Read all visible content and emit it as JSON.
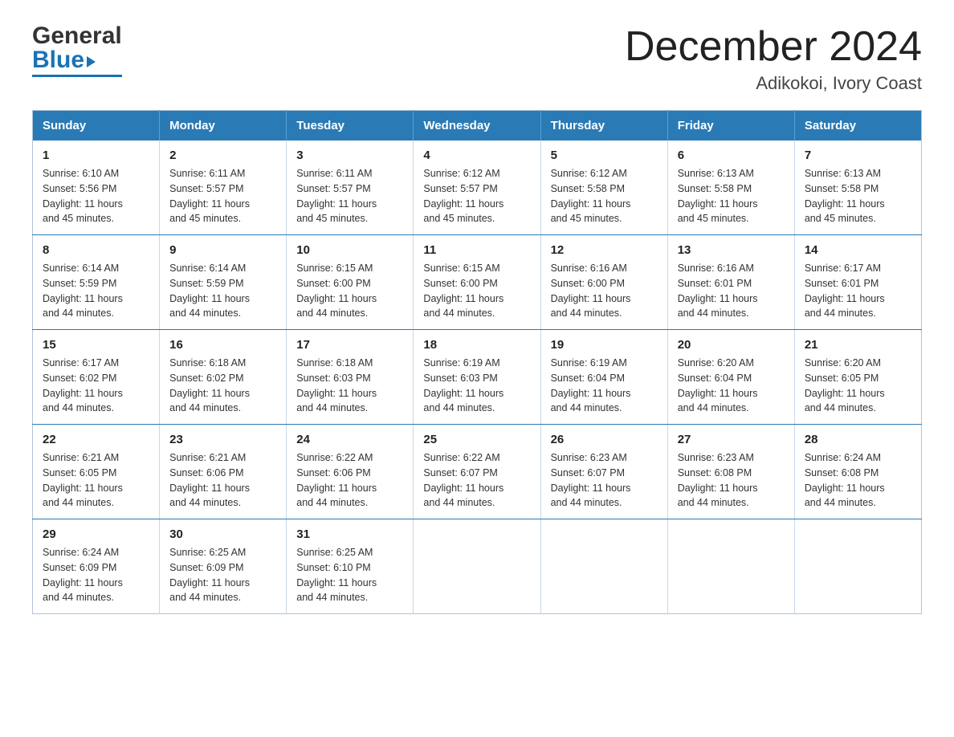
{
  "header": {
    "logo": {
      "general": "General",
      "blue": "Blue"
    },
    "title": "December 2024",
    "subtitle": "Adikokoi, Ivory Coast"
  },
  "calendar": {
    "days_of_week": [
      "Sunday",
      "Monday",
      "Tuesday",
      "Wednesday",
      "Thursday",
      "Friday",
      "Saturday"
    ],
    "weeks": [
      [
        {
          "day": "1",
          "sunrise": "6:10 AM",
          "sunset": "5:56 PM",
          "daylight": "11 hours and 45 minutes."
        },
        {
          "day": "2",
          "sunrise": "6:11 AM",
          "sunset": "5:57 PM",
          "daylight": "11 hours and 45 minutes."
        },
        {
          "day": "3",
          "sunrise": "6:11 AM",
          "sunset": "5:57 PM",
          "daylight": "11 hours and 45 minutes."
        },
        {
          "day": "4",
          "sunrise": "6:12 AM",
          "sunset": "5:57 PM",
          "daylight": "11 hours and 45 minutes."
        },
        {
          "day": "5",
          "sunrise": "6:12 AM",
          "sunset": "5:58 PM",
          "daylight": "11 hours and 45 minutes."
        },
        {
          "day": "6",
          "sunrise": "6:13 AM",
          "sunset": "5:58 PM",
          "daylight": "11 hours and 45 minutes."
        },
        {
          "day": "7",
          "sunrise": "6:13 AM",
          "sunset": "5:58 PM",
          "daylight": "11 hours and 45 minutes."
        }
      ],
      [
        {
          "day": "8",
          "sunrise": "6:14 AM",
          "sunset": "5:59 PM",
          "daylight": "11 hours and 44 minutes."
        },
        {
          "day": "9",
          "sunrise": "6:14 AM",
          "sunset": "5:59 PM",
          "daylight": "11 hours and 44 minutes."
        },
        {
          "day": "10",
          "sunrise": "6:15 AM",
          "sunset": "6:00 PM",
          "daylight": "11 hours and 44 minutes."
        },
        {
          "day": "11",
          "sunrise": "6:15 AM",
          "sunset": "6:00 PM",
          "daylight": "11 hours and 44 minutes."
        },
        {
          "day": "12",
          "sunrise": "6:16 AM",
          "sunset": "6:00 PM",
          "daylight": "11 hours and 44 minutes."
        },
        {
          "day": "13",
          "sunrise": "6:16 AM",
          "sunset": "6:01 PM",
          "daylight": "11 hours and 44 minutes."
        },
        {
          "day": "14",
          "sunrise": "6:17 AM",
          "sunset": "6:01 PM",
          "daylight": "11 hours and 44 minutes."
        }
      ],
      [
        {
          "day": "15",
          "sunrise": "6:17 AM",
          "sunset": "6:02 PM",
          "daylight": "11 hours and 44 minutes."
        },
        {
          "day": "16",
          "sunrise": "6:18 AM",
          "sunset": "6:02 PM",
          "daylight": "11 hours and 44 minutes."
        },
        {
          "day": "17",
          "sunrise": "6:18 AM",
          "sunset": "6:03 PM",
          "daylight": "11 hours and 44 minutes."
        },
        {
          "day": "18",
          "sunrise": "6:19 AM",
          "sunset": "6:03 PM",
          "daylight": "11 hours and 44 minutes."
        },
        {
          "day": "19",
          "sunrise": "6:19 AM",
          "sunset": "6:04 PM",
          "daylight": "11 hours and 44 minutes."
        },
        {
          "day": "20",
          "sunrise": "6:20 AM",
          "sunset": "6:04 PM",
          "daylight": "11 hours and 44 minutes."
        },
        {
          "day": "21",
          "sunrise": "6:20 AM",
          "sunset": "6:05 PM",
          "daylight": "11 hours and 44 minutes."
        }
      ],
      [
        {
          "day": "22",
          "sunrise": "6:21 AM",
          "sunset": "6:05 PM",
          "daylight": "11 hours and 44 minutes."
        },
        {
          "day": "23",
          "sunrise": "6:21 AM",
          "sunset": "6:06 PM",
          "daylight": "11 hours and 44 minutes."
        },
        {
          "day": "24",
          "sunrise": "6:22 AM",
          "sunset": "6:06 PM",
          "daylight": "11 hours and 44 minutes."
        },
        {
          "day": "25",
          "sunrise": "6:22 AM",
          "sunset": "6:07 PM",
          "daylight": "11 hours and 44 minutes."
        },
        {
          "day": "26",
          "sunrise": "6:23 AM",
          "sunset": "6:07 PM",
          "daylight": "11 hours and 44 minutes."
        },
        {
          "day": "27",
          "sunrise": "6:23 AM",
          "sunset": "6:08 PM",
          "daylight": "11 hours and 44 minutes."
        },
        {
          "day": "28",
          "sunrise": "6:24 AM",
          "sunset": "6:08 PM",
          "daylight": "11 hours and 44 minutes."
        }
      ],
      [
        {
          "day": "29",
          "sunrise": "6:24 AM",
          "sunset": "6:09 PM",
          "daylight": "11 hours and 44 minutes."
        },
        {
          "day": "30",
          "sunrise": "6:25 AM",
          "sunset": "6:09 PM",
          "daylight": "11 hours and 44 minutes."
        },
        {
          "day": "31",
          "sunrise": "6:25 AM",
          "sunset": "6:10 PM",
          "daylight": "11 hours and 44 minutes."
        },
        null,
        null,
        null,
        null
      ]
    ],
    "labels": {
      "sunrise": "Sunrise:",
      "sunset": "Sunset:",
      "daylight": "Daylight:"
    }
  }
}
